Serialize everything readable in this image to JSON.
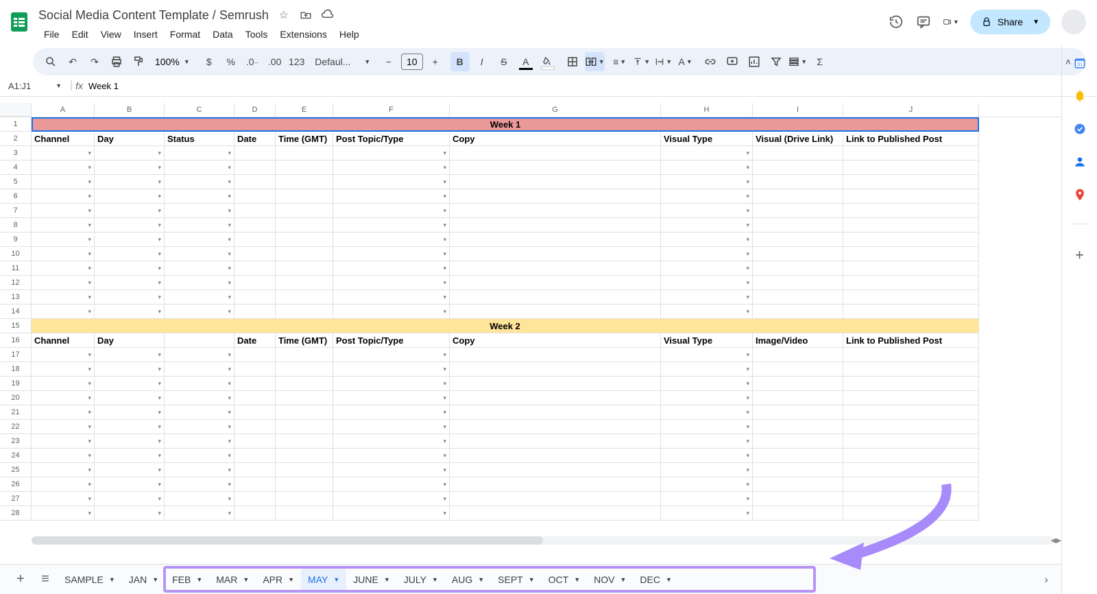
{
  "doc": {
    "title": "Social Media Content Template / Semrush"
  },
  "menus": [
    "File",
    "Edit",
    "View",
    "Insert",
    "Format",
    "Data",
    "Tools",
    "Extensions",
    "Help"
  ],
  "share": {
    "label": "Share"
  },
  "toolbar": {
    "zoom": "100%",
    "font": "Defaul...",
    "fontSize": "10"
  },
  "namebox": {
    "ref": "A1:J1",
    "formula": "Week 1"
  },
  "columns": [
    "A",
    "B",
    "C",
    "D",
    "E",
    "F",
    "G",
    "H",
    "I",
    "J"
  ],
  "rows": [
    1,
    2,
    3,
    4,
    5,
    6,
    7,
    8,
    9,
    10,
    11,
    12,
    13,
    14,
    15,
    16,
    17,
    18,
    19,
    20,
    21,
    22,
    23,
    24,
    25,
    26,
    27,
    28
  ],
  "week1": {
    "title": "Week 1",
    "headers": [
      "Channel",
      "Day",
      "Status",
      "Date",
      "Time (GMT)",
      "Post Topic/Type",
      "Copy",
      "Visual Type",
      "Visual (Drive Link)",
      "Link to Published Post"
    ]
  },
  "week2": {
    "title": "Week 2",
    "headers": [
      "Channel",
      "Day",
      "",
      "Date",
      "Time (GMT)",
      "Post Topic/Type",
      "Copy",
      "Visual Type",
      "Image/Video",
      "Link to Published Post"
    ]
  },
  "tabs": [
    "SAMPLE",
    "JAN",
    "FEB",
    "MAR",
    "APR",
    "MAY",
    "JUNE",
    "JULY",
    "AUG",
    "SEPT",
    "OCT",
    "NOV",
    "DEC"
  ],
  "activeTab": "MAY"
}
